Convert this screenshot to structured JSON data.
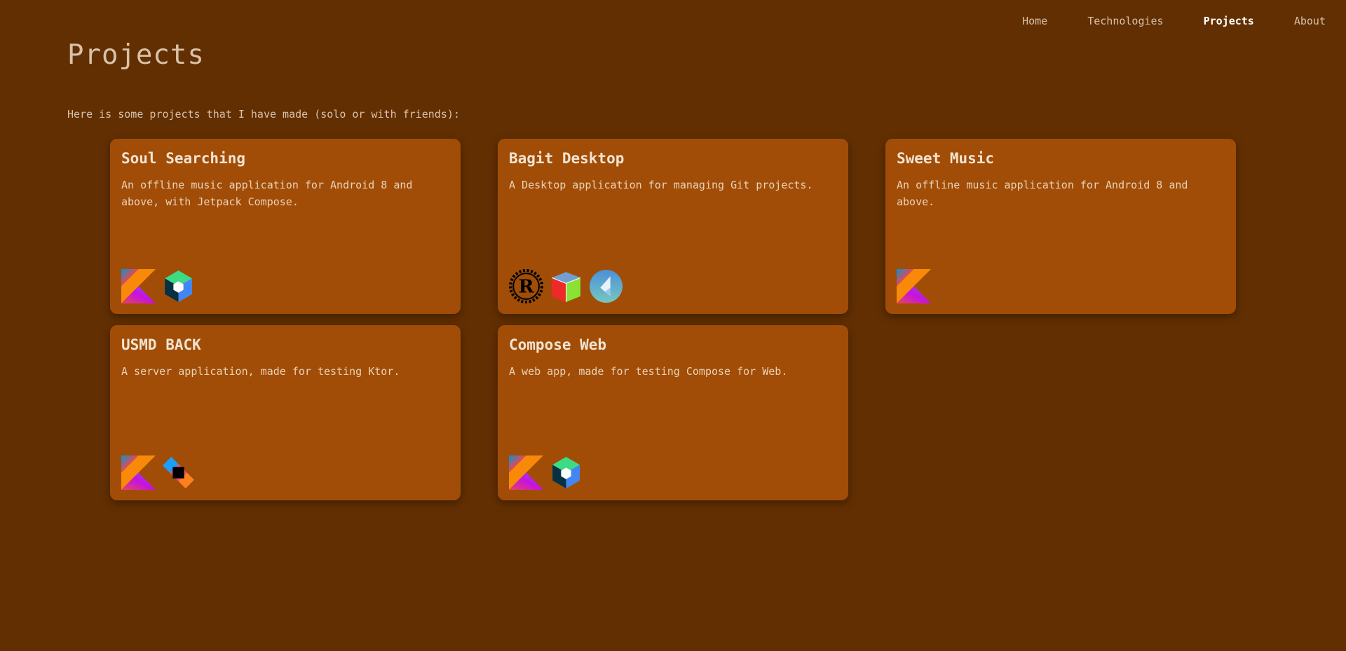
{
  "nav": {
    "items": [
      {
        "label": "Home"
      },
      {
        "label": "Technologies"
      },
      {
        "label": "Projects",
        "active": true
      },
      {
        "label": "About"
      }
    ]
  },
  "page": {
    "title": "Projects",
    "intro": "Here is some projects that I have made (solo or with friends):"
  },
  "projects": [
    {
      "name": "Soul Searching",
      "description": "An offline music application for Android 8 and above, with Jetpack Compose.",
      "icons": [
        "kotlin-icon",
        "jetpack-compose-icon"
      ]
    },
    {
      "name": "Bagit Desktop",
      "description": "A Desktop application for managing Git projects.",
      "icons": [
        "rust-icon",
        "gtk-icon",
        "flutter-like-icon"
      ]
    },
    {
      "name": "Sweet Music",
      "description": "An offline music application for Android 8 and above.",
      "icons": [
        "kotlin-icon"
      ]
    },
    {
      "name": "USMD BACK",
      "description": "A server application, made for testing Ktor.",
      "icons": [
        "kotlin-icon",
        "ktor-icon"
      ]
    },
    {
      "name": "Compose Web",
      "description": "A web app, made for testing Compose for Web.",
      "icons": [
        "kotlin-icon",
        "jetpack-compose-icon"
      ]
    }
  ],
  "colors": {
    "background": "#622f02",
    "card": "#a14d07",
    "text": "#d8c2a8"
  }
}
